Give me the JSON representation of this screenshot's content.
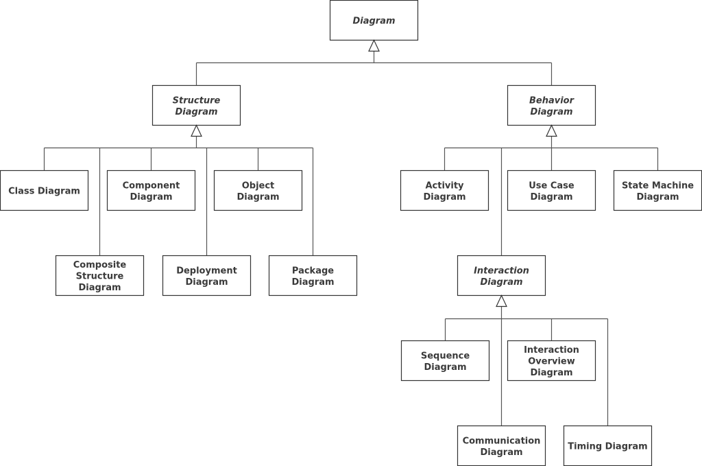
{
  "diagram": {
    "type": "UML diagram taxonomy (generalization hierarchy)",
    "nodes": [
      {
        "id": "diagram",
        "lines": [
          "Diagram"
        ],
        "abstract": true
      },
      {
        "id": "structure",
        "lines": [
          "Structure",
          "Diagram"
        ],
        "abstract": true,
        "parent": "diagram"
      },
      {
        "id": "behavior",
        "lines": [
          "Behavior",
          "Diagram"
        ],
        "abstract": true,
        "parent": "diagram"
      },
      {
        "id": "class",
        "lines": [
          "Class Diagram"
        ],
        "abstract": false,
        "parent": "structure"
      },
      {
        "id": "component",
        "lines": [
          "Component",
          "Diagram"
        ],
        "abstract": false,
        "parent": "structure"
      },
      {
        "id": "object",
        "lines": [
          "Object",
          "Diagram"
        ],
        "abstract": false,
        "parent": "structure"
      },
      {
        "id": "composite",
        "lines": [
          "Composite",
          "Structure",
          "Diagram"
        ],
        "abstract": false,
        "parent": "structure"
      },
      {
        "id": "deployment",
        "lines": [
          "Deployment",
          "Diagram"
        ],
        "abstract": false,
        "parent": "structure"
      },
      {
        "id": "package",
        "lines": [
          "Package",
          "Diagram"
        ],
        "abstract": false,
        "parent": "structure"
      },
      {
        "id": "activity",
        "lines": [
          "Activity",
          "Diagram"
        ],
        "abstract": false,
        "parent": "behavior"
      },
      {
        "id": "usecase",
        "lines": [
          "Use Case",
          "Diagram"
        ],
        "abstract": false,
        "parent": "behavior"
      },
      {
        "id": "statemachine",
        "lines": [
          "State Machine",
          "Diagram"
        ],
        "abstract": false,
        "parent": "behavior"
      },
      {
        "id": "interaction",
        "lines": [
          "Interaction",
          "Diagram"
        ],
        "abstract": true,
        "parent": "behavior"
      },
      {
        "id": "sequence",
        "lines": [
          "Sequence",
          "Diagram"
        ],
        "abstract": false,
        "parent": "interaction"
      },
      {
        "id": "interactionoverview",
        "lines": [
          "Interaction",
          "Overview",
          "Diagram"
        ],
        "abstract": false,
        "parent": "interaction"
      },
      {
        "id": "communication",
        "lines": [
          "Communication",
          "Diagram"
        ],
        "abstract": false,
        "parent": "interaction"
      },
      {
        "id": "timing",
        "lines": [
          "Timing Diagram"
        ],
        "abstract": false,
        "parent": "interaction"
      }
    ],
    "edge_style": "generalization (hollow triangle arrowhead at parent)"
  }
}
